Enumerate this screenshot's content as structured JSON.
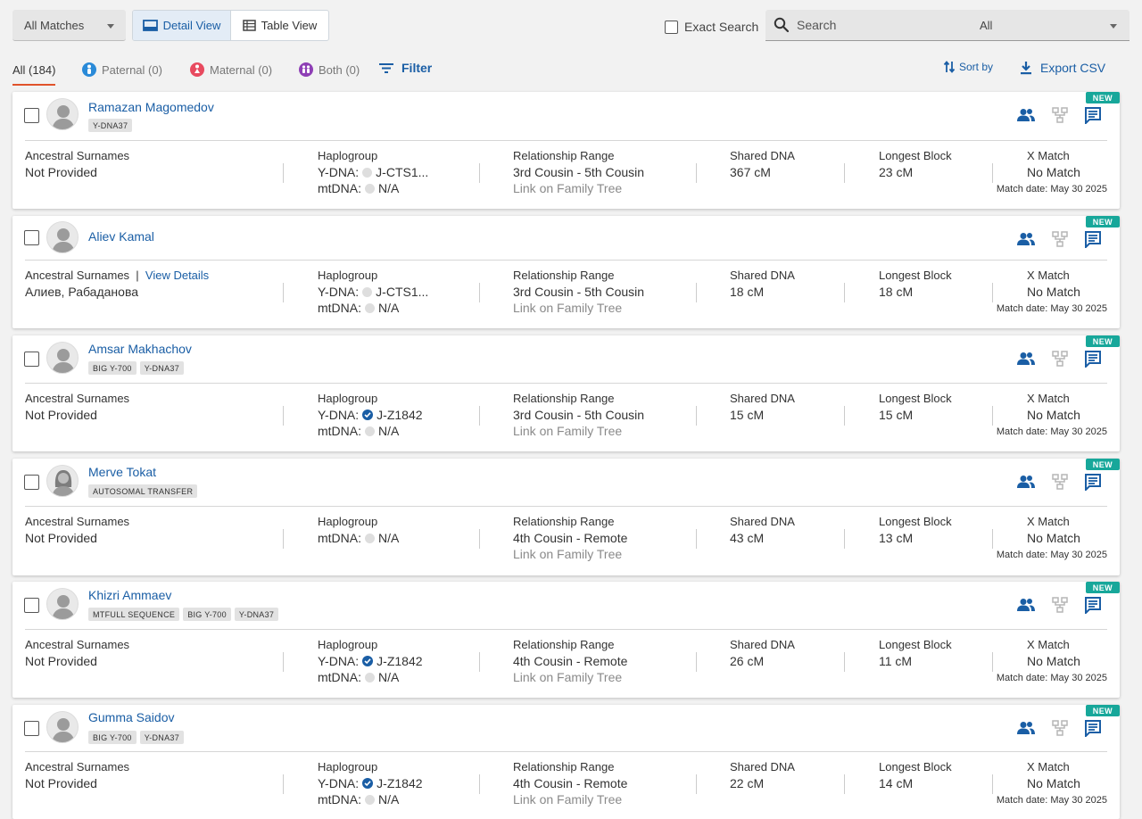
{
  "toolbar": {
    "match_filter": "All Matches",
    "detail_view": "Detail View",
    "table_view": "Table View",
    "exact_search": "Exact Search",
    "search_placeholder": "Search",
    "search_scope": "All"
  },
  "tabs": {
    "all": "All (184)",
    "paternal": "Paternal (0)",
    "maternal": "Maternal (0)",
    "both": "Both (0)",
    "filter": "Filter",
    "sort": "Sort by",
    "export": "Export CSV"
  },
  "colors": {
    "link_blue": "#1a5ea5",
    "new_badge": "#17a79a",
    "paternal": "#2a8ad8",
    "maternal": "#e84a5f",
    "both": "#8e3fb5",
    "active_tab_underline": "#e0532b"
  },
  "labels": {
    "ancestral_surnames": "Ancestral Surnames",
    "view_details": "View Details",
    "haplogroup": "Haplogroup",
    "relationship_range": "Relationship Range",
    "shared_dna": "Shared DNA",
    "longest_block": "Longest Block",
    "x_match": "X Match",
    "ydna_prefix": "Y-DNA:",
    "mtdna_prefix": "mtDNA:",
    "link_tree": "Link on Family Tree",
    "new_badge": "NEW"
  },
  "icons": [
    "person-icon",
    "people-icon",
    "family-tree-icon",
    "message-icon",
    "search-icon",
    "detail-view-icon",
    "table-view-icon",
    "filter-icon",
    "sort-icon",
    "download-icon",
    "check-circle-icon"
  ],
  "matches": [
    {
      "name": "Ramazan Magomedov",
      "tags": [
        "Y-DNA37"
      ],
      "surnames": "Not Provided",
      "has_view_details": false,
      "ydna": "J-CTS1...",
      "ydna_confirmed": false,
      "mtdna": "N/A",
      "relationship": "3rd Cousin - 5th Cousin",
      "shared_dna": "367 cM",
      "longest_block": "23 cM",
      "x_match": "No Match",
      "match_date": "Match date: May 30 2025",
      "avatar": "male"
    },
    {
      "name": "Aliev Kamal",
      "tags": [],
      "surnames": "Алиев, Рабаданова",
      "has_view_details": true,
      "ydna": "J-CTS1...",
      "ydna_confirmed": false,
      "mtdna": "N/A",
      "relationship": "3rd Cousin - 5th Cousin",
      "shared_dna": "18 cM",
      "longest_block": "18 cM",
      "x_match": "No Match",
      "match_date": "Match date: May 30 2025",
      "avatar": "male"
    },
    {
      "name": "Amsar Makhachov",
      "tags": [
        "BIG Y-700",
        "Y-DNA37"
      ],
      "surnames": "Not Provided",
      "has_view_details": false,
      "ydna": "J-Z1842",
      "ydna_confirmed": true,
      "mtdna": "N/A",
      "relationship": "3rd Cousin - 5th Cousin",
      "shared_dna": "15 cM",
      "longest_block": "15 cM",
      "x_match": "No Match",
      "match_date": "Match date: May 30 2025",
      "avatar": "male"
    },
    {
      "name": "Merve Tokat",
      "tags": [
        "Autosomal Transfer"
      ],
      "surnames": "Not Provided",
      "has_view_details": false,
      "ydna": null,
      "ydna_confirmed": false,
      "mtdna": "N/A",
      "relationship": "4th Cousin - Remote",
      "shared_dna": "43 cM",
      "longest_block": "13 cM",
      "x_match": "No Match",
      "match_date": "Match date: May 30 2025",
      "avatar": "female"
    },
    {
      "name": "Khizri Ammaev",
      "tags": [
        "MTFull Sequence",
        "BIG Y-700",
        "Y-DNA37"
      ],
      "surnames": "Not Provided",
      "has_view_details": false,
      "ydna": "J-Z1842",
      "ydna_confirmed": true,
      "mtdna": "N/A",
      "relationship": "4th Cousin - Remote",
      "shared_dna": "26 cM",
      "longest_block": "11 cM",
      "x_match": "No Match",
      "match_date": "Match date: May 30 2025",
      "avatar": "male"
    },
    {
      "name": "Gumma Saidov",
      "tags": [
        "BIG Y-700",
        "Y-DNA37"
      ],
      "surnames": "Not Provided",
      "has_view_details": false,
      "ydna": "J-Z1842",
      "ydna_confirmed": true,
      "mtdna": "N/A",
      "relationship": "4th Cousin - Remote",
      "shared_dna": "22 cM",
      "longest_block": "14 cM",
      "x_match": "No Match",
      "match_date": "Match date: May 30 2025",
      "avatar": "male"
    }
  ]
}
